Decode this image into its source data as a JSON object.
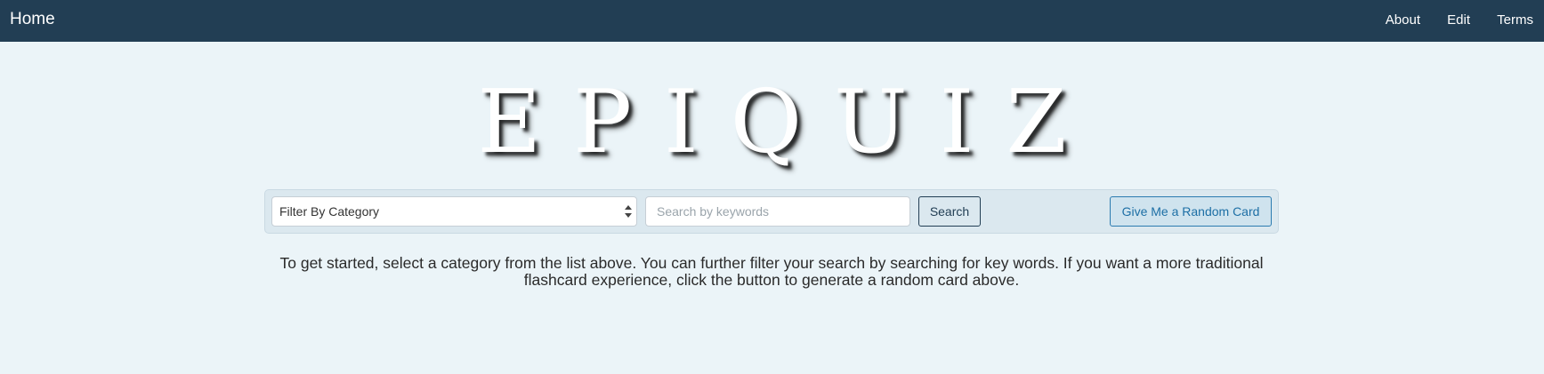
{
  "nav": {
    "home": "Home",
    "links": [
      "About",
      "Edit",
      "Terms"
    ]
  },
  "logo": {
    "text": "EPIQUIZ"
  },
  "search": {
    "category_selected": "Filter By Category",
    "keywords_placeholder": "Search by keywords",
    "keywords_value": "",
    "search_button": "Search",
    "random_button": "Give Me a Random Card"
  },
  "intro": {
    "text": "To get started, select a category from the list above. You can further filter your search by searching for key words. If you want a more traditional flashcard experience, click the button to generate a random card above."
  },
  "colors": {
    "navbar": "#223e54",
    "background": "#ebf4f8",
    "well": "#dbe8ef",
    "accent": "#1d6fa5"
  },
  "icons": {
    "select_arrows": "up-down-caret-icon"
  }
}
